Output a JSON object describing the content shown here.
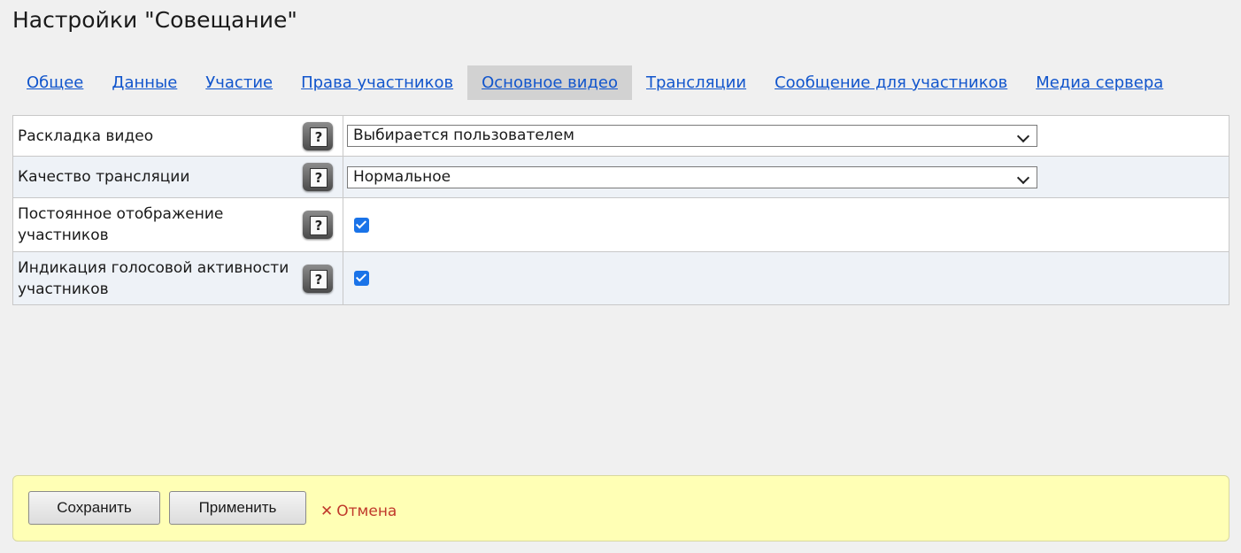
{
  "page": {
    "title": "Настройки \"Совещание\""
  },
  "tabs": [
    {
      "label": "Общее",
      "active": false
    },
    {
      "label": "Данные",
      "active": false
    },
    {
      "label": "Участие",
      "active": false
    },
    {
      "label": "Права участников",
      "active": false
    },
    {
      "label": "Основное видео",
      "active": true
    },
    {
      "label": "Трансляции",
      "active": false
    },
    {
      "label": "Сообщение для участников",
      "active": false
    },
    {
      "label": "Медиа сервера",
      "active": false
    }
  ],
  "settings": {
    "rows": [
      {
        "label": "Раскладка видео",
        "control": "select",
        "value": "Выбирается пользователем",
        "help_icon": "question-icon"
      },
      {
        "label": "Качество трансляции",
        "control": "select",
        "value": "Нормальное",
        "help_icon": "question-icon"
      },
      {
        "label": "Постоянное отображение участников",
        "control": "checkbox",
        "checked": true,
        "help_icon": "question-icon"
      },
      {
        "label": "Индикация голосовой активности участников",
        "control": "checkbox",
        "checked": true,
        "help_icon": "question-icon"
      }
    ]
  },
  "footer": {
    "save_label": "Сохранить",
    "apply_label": "Применить",
    "cancel_label": "Отмена",
    "cancel_icon": "✕"
  },
  "colors": {
    "link": "#1155cc",
    "active_tab_bg": "#d2d2d2",
    "footer_bg": "#ffffb5",
    "cancel": "#c0392b",
    "checkbox": "#1a73e8"
  }
}
